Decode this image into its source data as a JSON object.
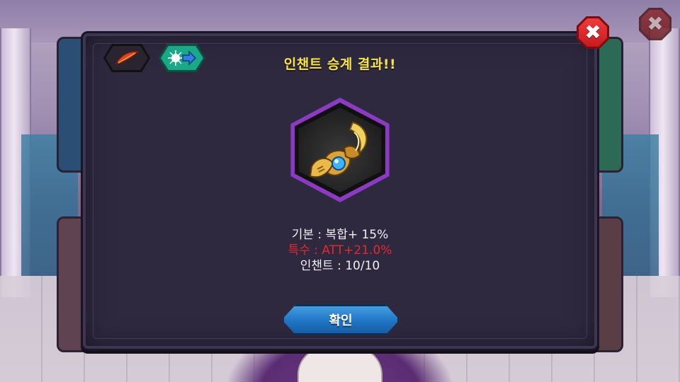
{
  "dialog": {
    "title": "인챈트 승계 결과!!",
    "stats": {
      "base": "기본 : 복합+ 15%",
      "special": "특수 : ATT+21.0%",
      "enchant": "인챈트 : 10/10"
    },
    "confirm_label": "확인",
    "close_label": "✖"
  },
  "background": {
    "close_label": "✖"
  },
  "icons": {
    "top_left": [
      "feather-icon",
      "transfer-arrow-icon"
    ],
    "item": "golden-horn-gem-ornament-icon"
  },
  "colors": {
    "title": "#f5e14a",
    "special_stat": "#e6282d",
    "item_frame": "#8a3bc2",
    "confirm_button": "#1f74c4",
    "close_button": "#d42428"
  }
}
